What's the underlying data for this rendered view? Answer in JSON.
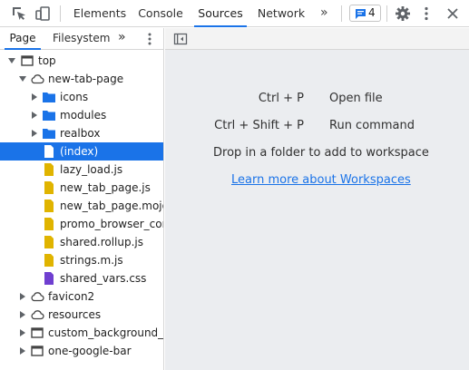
{
  "toolbar": {
    "tabs": [
      {
        "label": "Elements"
      },
      {
        "label": "Console"
      },
      {
        "label": "Sources"
      },
      {
        "label": "Network"
      }
    ],
    "more_glyph": "»",
    "issues_count": "4",
    "accent_color": "#1a73e8"
  },
  "navigator": {
    "tabs": [
      {
        "label": "Page"
      },
      {
        "label": "Filesystem"
      }
    ],
    "more_glyph": "»",
    "tree": [
      {
        "label": "top",
        "icon": "frame-icon"
      },
      {
        "label": "new-tab-page",
        "icon": "cloud-icon"
      },
      {
        "label": "icons",
        "icon": "folder-icon"
      },
      {
        "label": "modules",
        "icon": "folder-icon"
      },
      {
        "label": "realbox",
        "icon": "folder-icon"
      },
      {
        "label": "(index)",
        "icon": "document-icon"
      },
      {
        "label": "lazy_load.js",
        "icon": "js-file-icon"
      },
      {
        "label": "new_tab_page.js",
        "icon": "js-file-icon"
      },
      {
        "label": "new_tab_page.mojom",
        "icon": "js-file-icon"
      },
      {
        "label": "promo_browser_comm",
        "icon": "js-file-icon"
      },
      {
        "label": "shared.rollup.js",
        "icon": "js-file-icon"
      },
      {
        "label": "strings.m.js",
        "icon": "js-file-icon"
      },
      {
        "label": "shared_vars.css",
        "icon": "css-file-icon"
      },
      {
        "label": "favicon2",
        "icon": "cloud-icon"
      },
      {
        "label": "resources",
        "icon": "cloud-icon"
      },
      {
        "label": "custom_background_ima",
        "icon": "frame-icon"
      },
      {
        "label": "one-google-bar",
        "icon": "frame-icon"
      }
    ]
  },
  "editor": {
    "shortcuts": [
      {
        "keys": "Ctrl + P",
        "action": "Open file"
      },
      {
        "keys": "Ctrl + Shift + P",
        "action": "Run command"
      }
    ],
    "drop_message": "Drop in a folder to add to workspace",
    "learn_more_link": "Learn more about Workspaces"
  }
}
